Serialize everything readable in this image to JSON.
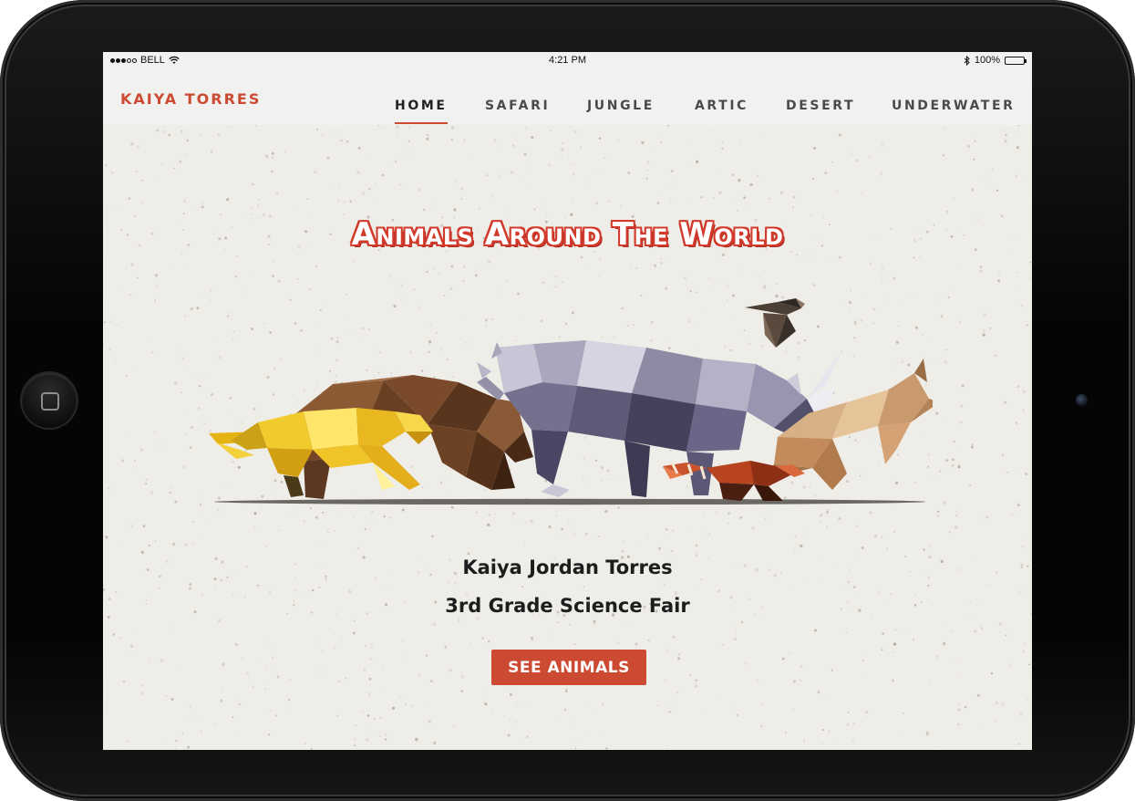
{
  "status_bar": {
    "carrier": "BELL",
    "time": "4:21 PM",
    "battery": "100%",
    "signal_strength": "3 of 5 dots"
  },
  "navbar": {
    "brand": "KAIYA TORRES",
    "items": [
      {
        "label": "HOME",
        "active": true
      },
      {
        "label": "SAFARI",
        "active": false
      },
      {
        "label": "JUNGLE",
        "active": false
      },
      {
        "label": "ARTIC",
        "active": false
      },
      {
        "label": "DESERT",
        "active": false
      },
      {
        "label": "UNDERWATER",
        "active": false
      }
    ]
  },
  "hero": {
    "title": "Animals Around The World",
    "student_name": "Kaiya Jordan Torres",
    "event": "3rd Grade Science Fair",
    "button_label": "SEE ANIMALS",
    "illustration_animals": [
      "cheetah",
      "bear",
      "rhinoceros",
      "hawk",
      "kangaroo",
      "red-panda"
    ]
  },
  "colors": {
    "accent": "#cc4a31",
    "background": "#efede8",
    "text": "#1d1d1d",
    "nav_background": "#f1f1f0"
  }
}
